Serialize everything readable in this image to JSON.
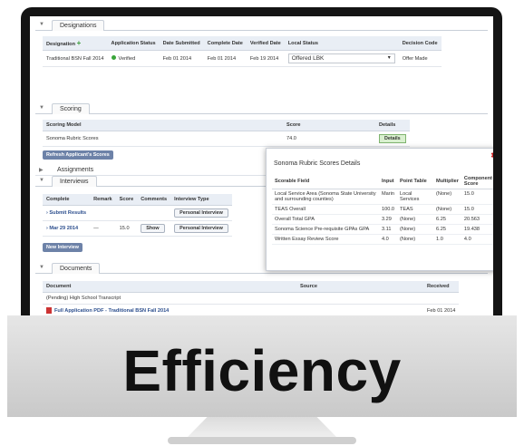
{
  "designations": {
    "tab": "Designations",
    "headers": [
      "Designation",
      "Application Status",
      "Date Submitted",
      "Complete Date",
      "Verified Date",
      "Local Status",
      "Decision Code"
    ],
    "row": {
      "designation": "Traditional BSN Fall 2014",
      "status": "Verified",
      "date_submitted": "Feb 01 2014",
      "complete_date": "Feb 01 2014",
      "verified_date": "Feb 19 2014",
      "local_status": "Offered LBK",
      "decision_code": "Offer Made"
    }
  },
  "scoring": {
    "tab": "Scoring",
    "headers": [
      "Scoring Model",
      "Score",
      "Details"
    ],
    "row": {
      "model": "Sonoma Rubric Scores",
      "score": "74.0",
      "details_button": "Details"
    },
    "refresh_button": "Refresh Applicant's Scores"
  },
  "assignments": {
    "tab": "Assignments"
  },
  "interviews": {
    "tab": "Interviews",
    "headers": [
      "Complete",
      "Remark",
      "Score",
      "Comments",
      "Interview Type"
    ],
    "rows": [
      {
        "complete": "Submit Results",
        "remark": "",
        "score": "",
        "comments": "",
        "type": "Personal Interview"
      },
      {
        "complete": "Mar 29 2014",
        "remark": "—",
        "score": "15.0",
        "comments": "Show",
        "type": "Personal Interview"
      }
    ],
    "new_button": "New Interview"
  },
  "documents": {
    "tab": "Documents",
    "headers": [
      "Document",
      "Source",
      "Received"
    ],
    "rows": [
      {
        "document": "(Pending) High School Transcript",
        "source": "",
        "received": ""
      },
      {
        "document": "Full Application PDF - Traditional BSN Fall 2014",
        "source": "",
        "received": "Feb 01 2014"
      }
    ]
  },
  "popup": {
    "title": "Sonoma Rubric Scores Details",
    "headers": [
      "Scorable Field",
      "Input",
      "Point Table",
      "Multiplier",
      "Component Score"
    ],
    "rows": [
      {
        "field": "Local Service Area (Sonoma State University and surrounding counties)",
        "input": "Marin",
        "table": "Local Services",
        "mult": "(None)",
        "score": "15.0"
      },
      {
        "field": "TEAS Overall",
        "input": "100.0",
        "table": "TEAS",
        "mult": "(None)",
        "score": "15.0"
      },
      {
        "field": "Overall Total GPA",
        "input": "3.29",
        "table": "(None)",
        "mult": "6.25",
        "score": "20.563"
      },
      {
        "field": "Sonoma Science Pre-requisite GPAs GPA",
        "input": "3.11",
        "table": "(None)",
        "mult": "6.25",
        "score": "19.438"
      },
      {
        "field": "Written Essay Review Score",
        "input": "4.0",
        "table": "(None)",
        "mult": "1.0",
        "score": "4.0"
      }
    ]
  },
  "caption": "Efficiency",
  "icons": {
    "plus": "plus-icon",
    "verified": "green-dot-icon",
    "close": "close-icon",
    "pdf": "pdf-icon"
  }
}
